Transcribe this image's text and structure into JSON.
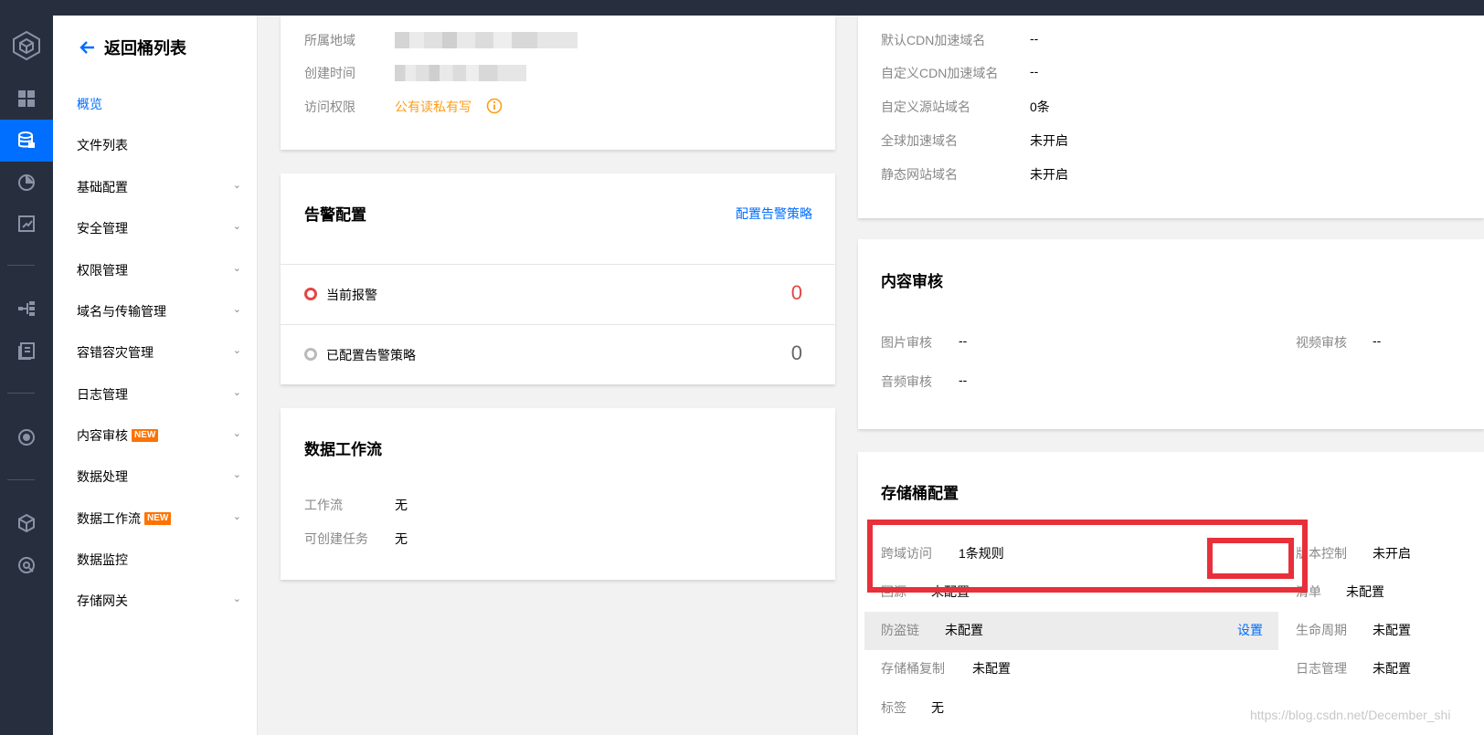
{
  "colors": {
    "rail": "#272f3e",
    "accent": "#006eff",
    "warning": "#ff9c19",
    "danger": "#e54545",
    "new_badge": "#ff7200",
    "highlight_box": "#e8303a"
  },
  "rail_icons": [
    "cube-logo-icon",
    "dashboard-icon",
    "storage-icon",
    "pie-chart-icon",
    "report-icon",
    "workflow-icon",
    "document-icon",
    "target-icon",
    "box-icon",
    "globe-icon"
  ],
  "subnav": {
    "back_label": "返回桶列表",
    "items": [
      {
        "label": "概览"
      },
      {
        "label": "文件列表"
      },
      {
        "label": "基础配置"
      },
      {
        "label": "安全管理"
      },
      {
        "label": "权限管理"
      },
      {
        "label": "域名与传输管理"
      },
      {
        "label": "容错容灾管理"
      },
      {
        "label": "日志管理"
      },
      {
        "label": "内容审核",
        "badge": "NEW"
      },
      {
        "label": "数据处理"
      },
      {
        "label": "数据工作流",
        "badge": "NEW"
      },
      {
        "label": "数据监控"
      },
      {
        "label": "存储网关"
      }
    ]
  },
  "basic_info": {
    "region_label": "所属地域",
    "created_label": "创建时间",
    "access_label": "访问权限",
    "access_value": "公有读私有写"
  },
  "alarm": {
    "title": "告警配置",
    "config_link": "配置告警策略",
    "current_label": "当前报警",
    "current_count": "0",
    "configured_label": "已配置告警策略",
    "configured_count": "0"
  },
  "workflow": {
    "title": "数据工作流",
    "workflow_label": "工作流",
    "workflow_value": "无",
    "task_label": "可创建任务",
    "task_value": "无"
  },
  "domain": {
    "default_cdn_label": "默认CDN加速域名",
    "default_cdn_value": "--",
    "custom_cdn_label": "自定义CDN加速域名",
    "custom_cdn_value": "--",
    "custom_origin_label": "自定义源站域名",
    "custom_origin_value": "0条",
    "global_label": "全球加速域名",
    "global_value": "未开启",
    "static_label": "静态网站域名",
    "static_value": "未开启"
  },
  "audit": {
    "title": "内容审核",
    "image_label": "图片审核",
    "image_value": "--",
    "video_label": "视频审核",
    "video_value": "--",
    "audio_label": "音频审核",
    "audio_value": "--"
  },
  "bucket_config": {
    "title": "存储桶配置",
    "cors_label": "跨域访问",
    "cors_value": "1条规则",
    "version_label": "版本控制",
    "version_value": "未开启",
    "origin_label": "回源",
    "origin_value": "未配置",
    "inventory_label": "清单",
    "inventory_value": "未配置",
    "hotlink_label": "防盗链",
    "hotlink_value": "未配置",
    "hotlink_action": "设置",
    "lifecycle_label": "生命周期",
    "lifecycle_value": "未配置",
    "replication_label": "存储桶复制",
    "replication_value": "未配置",
    "logging_label": "日志管理",
    "logging_value": "未配置",
    "tags_label": "标签",
    "tags_value": "无"
  },
  "watermark": "https://blog.csdn.net/December_shi"
}
